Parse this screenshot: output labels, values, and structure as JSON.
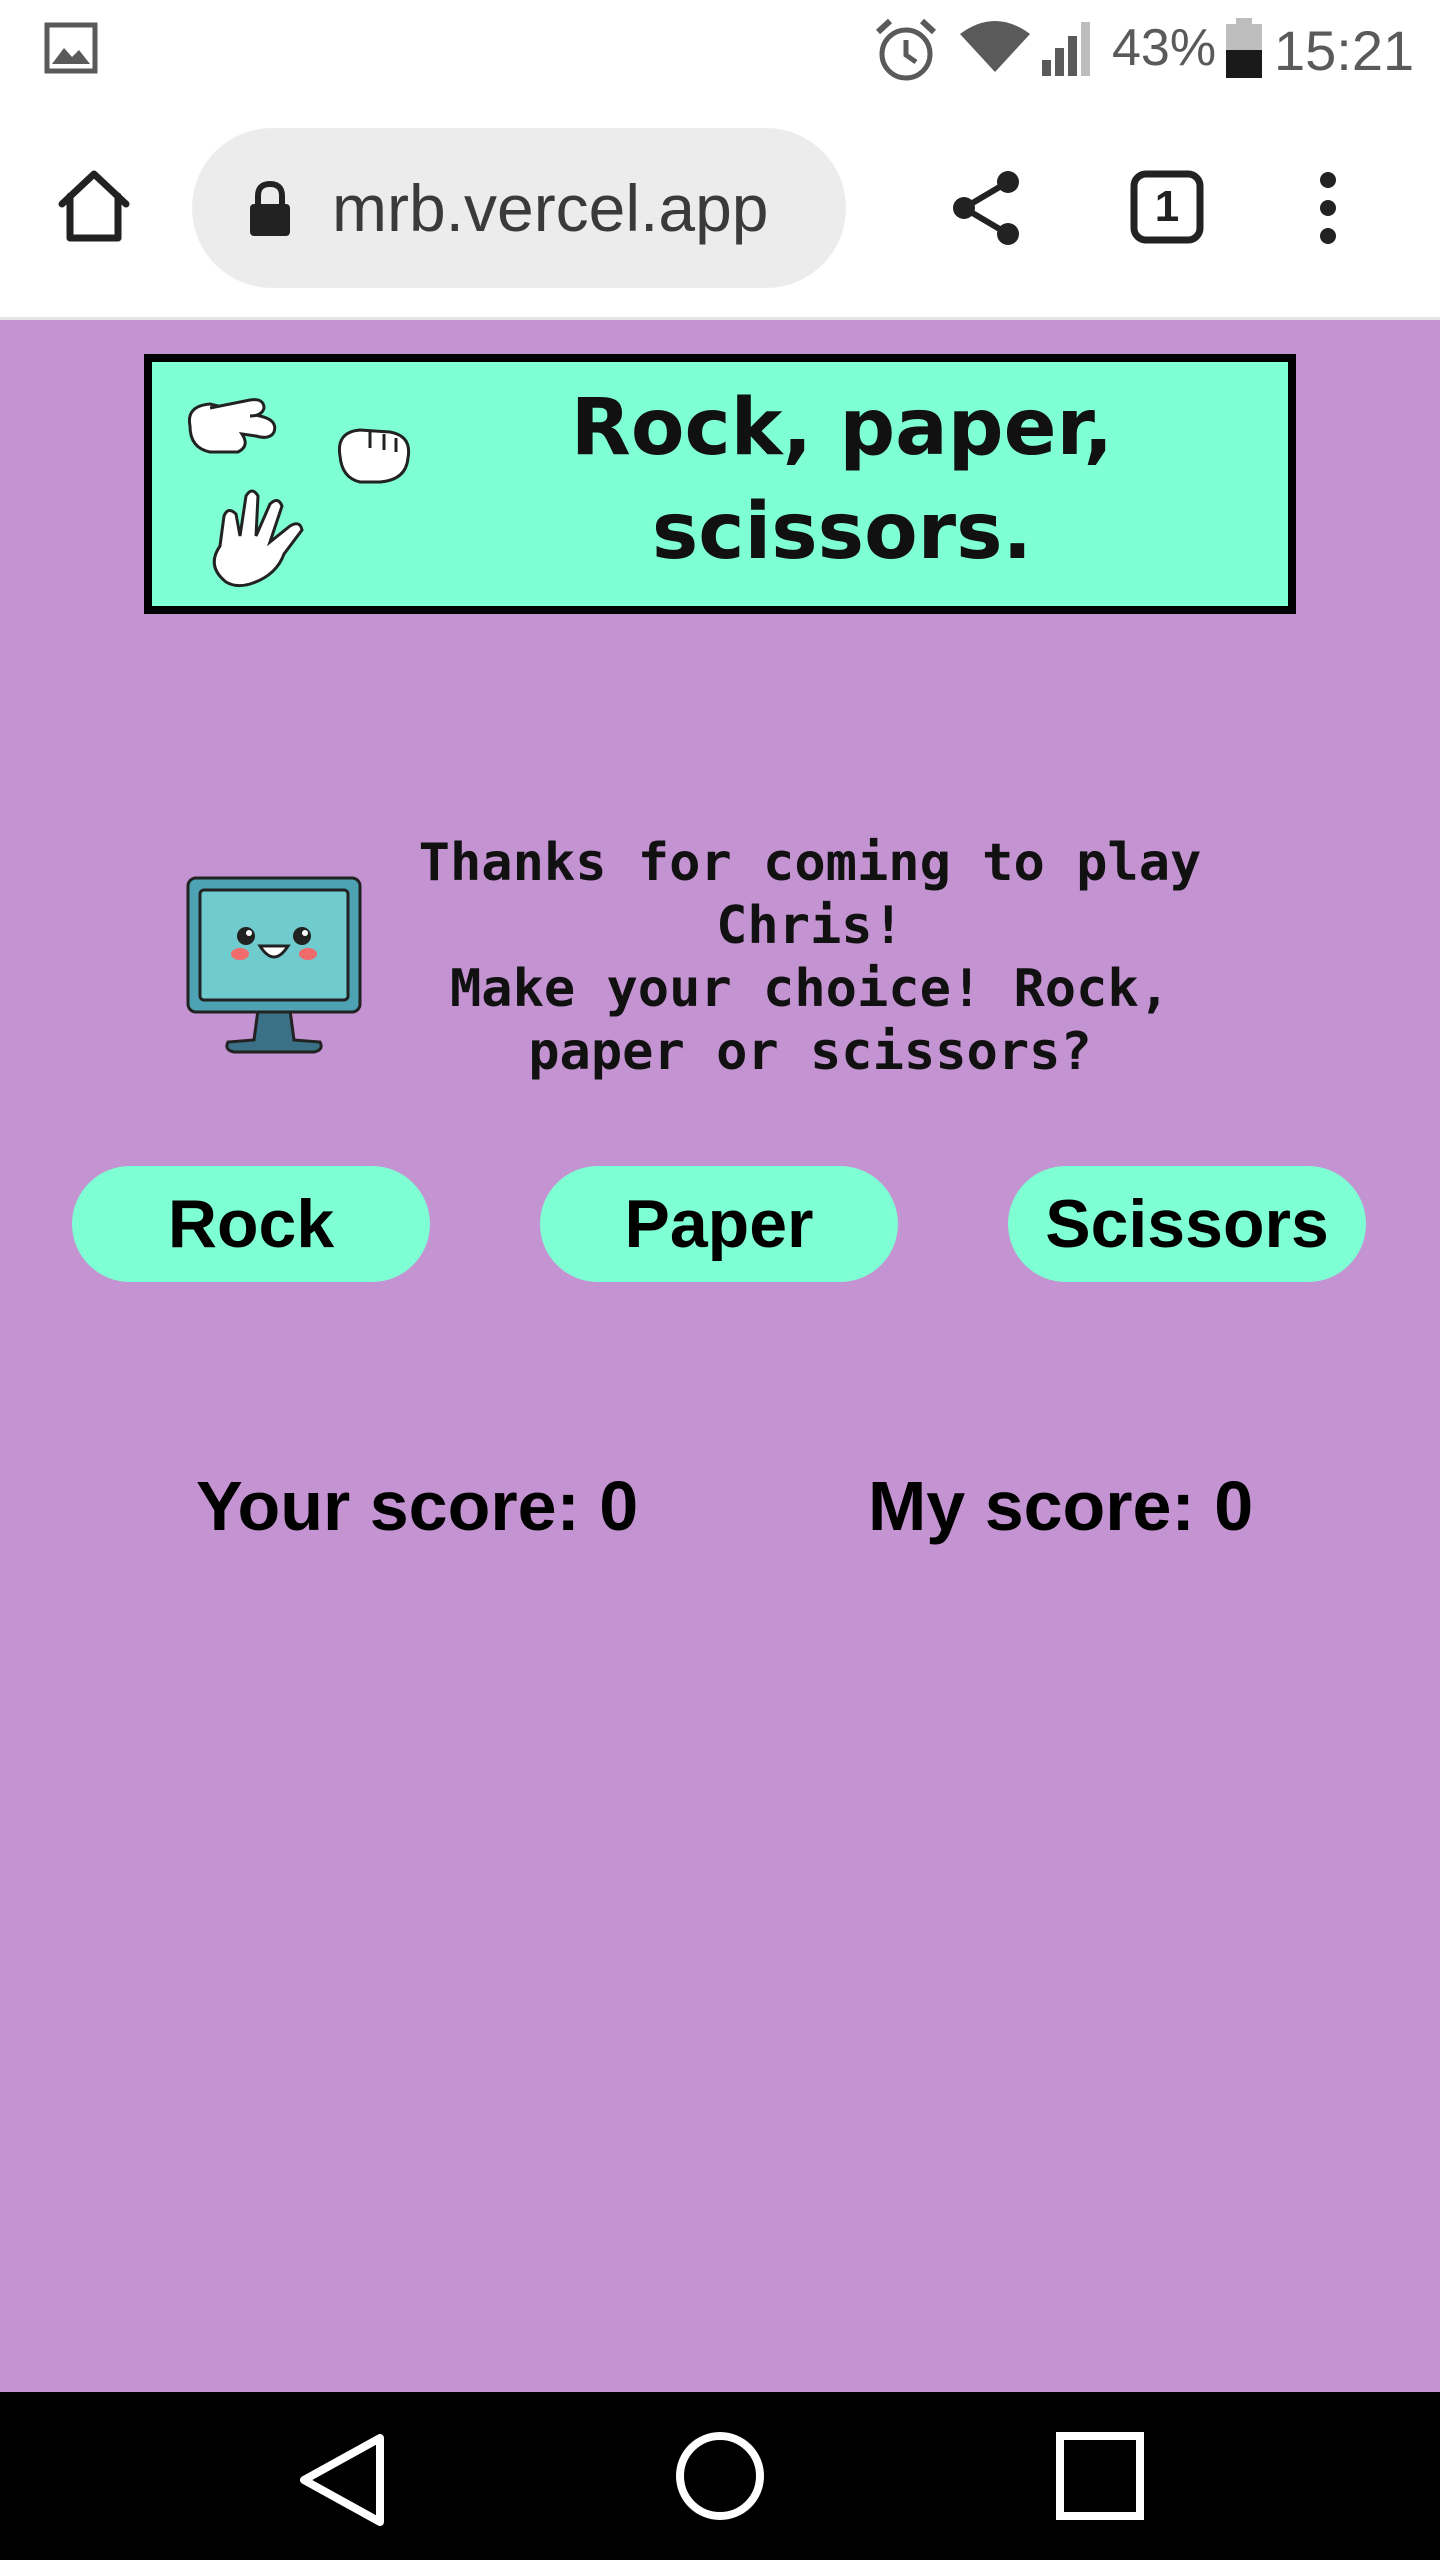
{
  "status_bar": {
    "battery_percent": "43%",
    "time": "15:21",
    "icons": [
      "gallery-icon",
      "alarm-icon",
      "wifi-icon",
      "signal-icon",
      "battery-icon"
    ]
  },
  "browser": {
    "url": "mrb.vercel.app",
    "tab_count": "1",
    "icons": [
      "home-icon",
      "lock-icon",
      "share-icon",
      "tabs-icon",
      "menu-icon"
    ]
  },
  "banner": {
    "title_line1": "Rock, paper,",
    "title_line2": "scissors."
  },
  "message": {
    "line1": "Thanks for coming to play",
    "line2": "Chris!",
    "line3": "Make your choice! Rock,",
    "line4": "paper or scissors?"
  },
  "choices": {
    "rock": "Rock",
    "paper": "Paper",
    "scissors": "Scissors"
  },
  "scores": {
    "your_score": "Your score: 0",
    "my_score": "My score: 0"
  },
  "nav": {
    "icons": [
      "back-icon",
      "home-circle-icon",
      "recents-icon"
    ]
  },
  "colors": {
    "page_background": "#c493d1",
    "accent": "#7fffd4",
    "border": "#000000"
  }
}
